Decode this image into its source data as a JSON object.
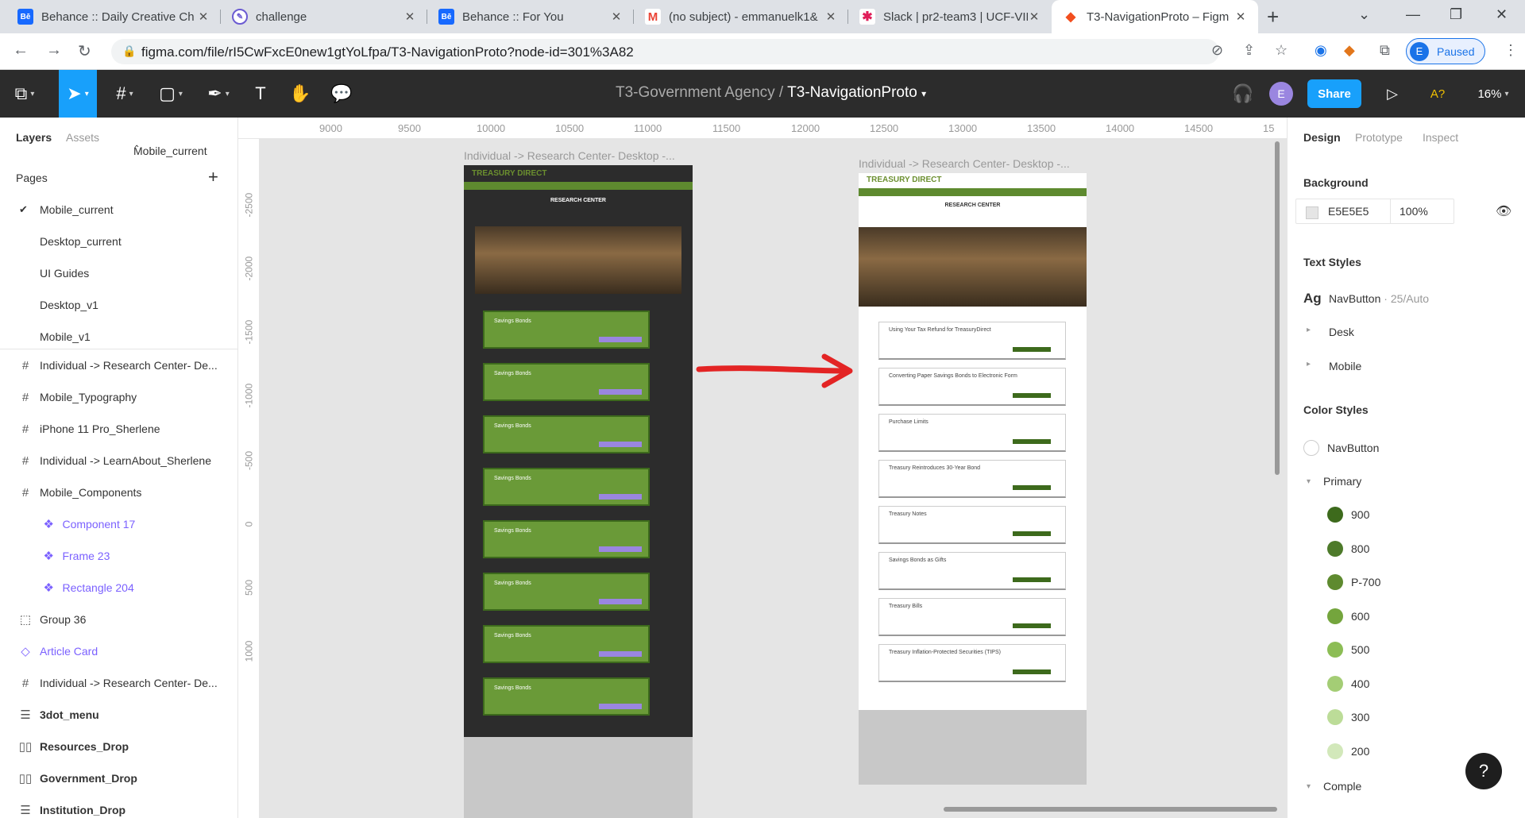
{
  "browser": {
    "tabs": [
      {
        "title": "Behance :: Daily Creative Ch",
        "icon": "behance-icon"
      },
      {
        "title": "challenge",
        "icon": "pencil-icon"
      },
      {
        "title": "Behance :: For You",
        "icon": "behance-icon"
      },
      {
        "title": "(no subject) - emmanuelk1&",
        "icon": "gmail-icon"
      },
      {
        "title": "Slack | pr2-team3 | UCF-VIR",
        "icon": "slack-icon"
      },
      {
        "title": "T3-NavigationProto – Figm",
        "icon": "figma-icon"
      }
    ],
    "url": "figma.com/file/rI5CwFxcE0new1gtYoLfpa/T3-NavigationProto?node-id=301%3A82",
    "profile_initial": "E",
    "profile_status": "Paused"
  },
  "figma": {
    "project": "T3-Government Agency",
    "file": "T3-NavigationProto",
    "share": "Share",
    "user_initial": "E",
    "zoom": "16%",
    "access": "A?"
  },
  "left": {
    "tab_layers": "Layers",
    "tab_assets": "Assets",
    "current_page": "Mobile_current",
    "pages_header": "Pages",
    "pages": [
      "Mobile_current",
      "Desktop_current",
      "UI Guides",
      "Desktop_v1",
      "Mobile_v1"
    ],
    "layers": [
      {
        "label": "Individual -> Research Center- De...",
        "icon": "#",
        "type": "frame"
      },
      {
        "label": "Mobile_Typography",
        "icon": "#",
        "type": "frame"
      },
      {
        "label": "iPhone 11 Pro_Sherlene",
        "icon": "#",
        "type": "frame"
      },
      {
        "label": "Individual -> LearnAbout_Sherlene",
        "icon": "#",
        "type": "frame"
      },
      {
        "label": "Mobile_Components",
        "icon": "#",
        "type": "frame"
      },
      {
        "label": "Component 17",
        "icon": "❖",
        "type": "comp-sub"
      },
      {
        "label": "Frame 23",
        "icon": "❖",
        "type": "comp-sub"
      },
      {
        "label": "Rectangle 204",
        "icon": "❖",
        "type": "comp-sub"
      },
      {
        "label": "Group 36",
        "icon": "⬚",
        "type": "group"
      },
      {
        "label": "Article Card",
        "icon": "◇",
        "type": "comp"
      },
      {
        "label": "Individual -> Research Center- De...",
        "icon": "#",
        "type": "frame"
      },
      {
        "label": "3dot_menu",
        "icon": "☰",
        "type": "bold"
      },
      {
        "label": "Resources_Drop",
        "icon": "▯▯",
        "type": "bold"
      },
      {
        "label": "Government_Drop",
        "icon": "▯▯",
        "type": "bold"
      },
      {
        "label": "Institution_Drop",
        "icon": "☰",
        "type": "bold"
      }
    ]
  },
  "canvas": {
    "ruler_x": [
      "9000",
      "9500",
      "10000",
      "10500",
      "11000",
      "11500",
      "12000",
      "12500",
      "13000",
      "13500",
      "14000",
      "14500",
      "15"
    ],
    "ruler_y": [
      "-2500",
      "-2000",
      "-1500",
      "-1000",
      "-500",
      "0",
      "500",
      "1000"
    ],
    "frame1_label": "Individual -> Research Center- Desktop -...",
    "frame2_label": "Individual -> Research Center- Desktop -...",
    "brand": "TREASURY DIRECT",
    "research": "RESEARCH CENTER",
    "mobile_card": "Savings Bonds",
    "articles": [
      "Using Your Tax Refund for TreasuryDirect",
      "Converting Paper Savings Bonds to Electronic Form",
      "Purchase Limits",
      "Treasury Reintroduces 30-Year Bond",
      "Treasury Notes",
      "Savings Bonds as Gifts",
      "Treasury Bills",
      "Treasury Inflation-Protected Securities (TIPS)"
    ]
  },
  "right": {
    "tab_design": "Design",
    "tab_prototype": "Prototype",
    "tab_inspect": "Inspect",
    "background": "Background",
    "bg_hex": "E5E5E5",
    "bg_opacity": "100%",
    "text_styles": "Text Styles",
    "ts_main": "NavButton",
    "ts_meta": "· 25/Auto",
    "ts_desk": "Desk",
    "ts_mobile": "Mobile",
    "color_styles": "Color Styles",
    "cs_nav": "NavButton",
    "cs_primary": "Primary",
    "colors": [
      {
        "name": "900",
        "hex": "#3d6a1c"
      },
      {
        "name": "800",
        "hex": "#4d7a2a"
      },
      {
        "name": "P-700",
        "hex": "#5e8a2f"
      },
      {
        "name": "600",
        "hex": "#74a53d"
      },
      {
        "name": "500",
        "hex": "#8cbd55"
      },
      {
        "name": "400",
        "hex": "#a4cd75"
      },
      {
        "name": "300",
        "hex": "#bcdc98"
      },
      {
        "name": "200",
        "hex": "#d2e8ba"
      }
    ],
    "cs_comple": "Comple"
  }
}
